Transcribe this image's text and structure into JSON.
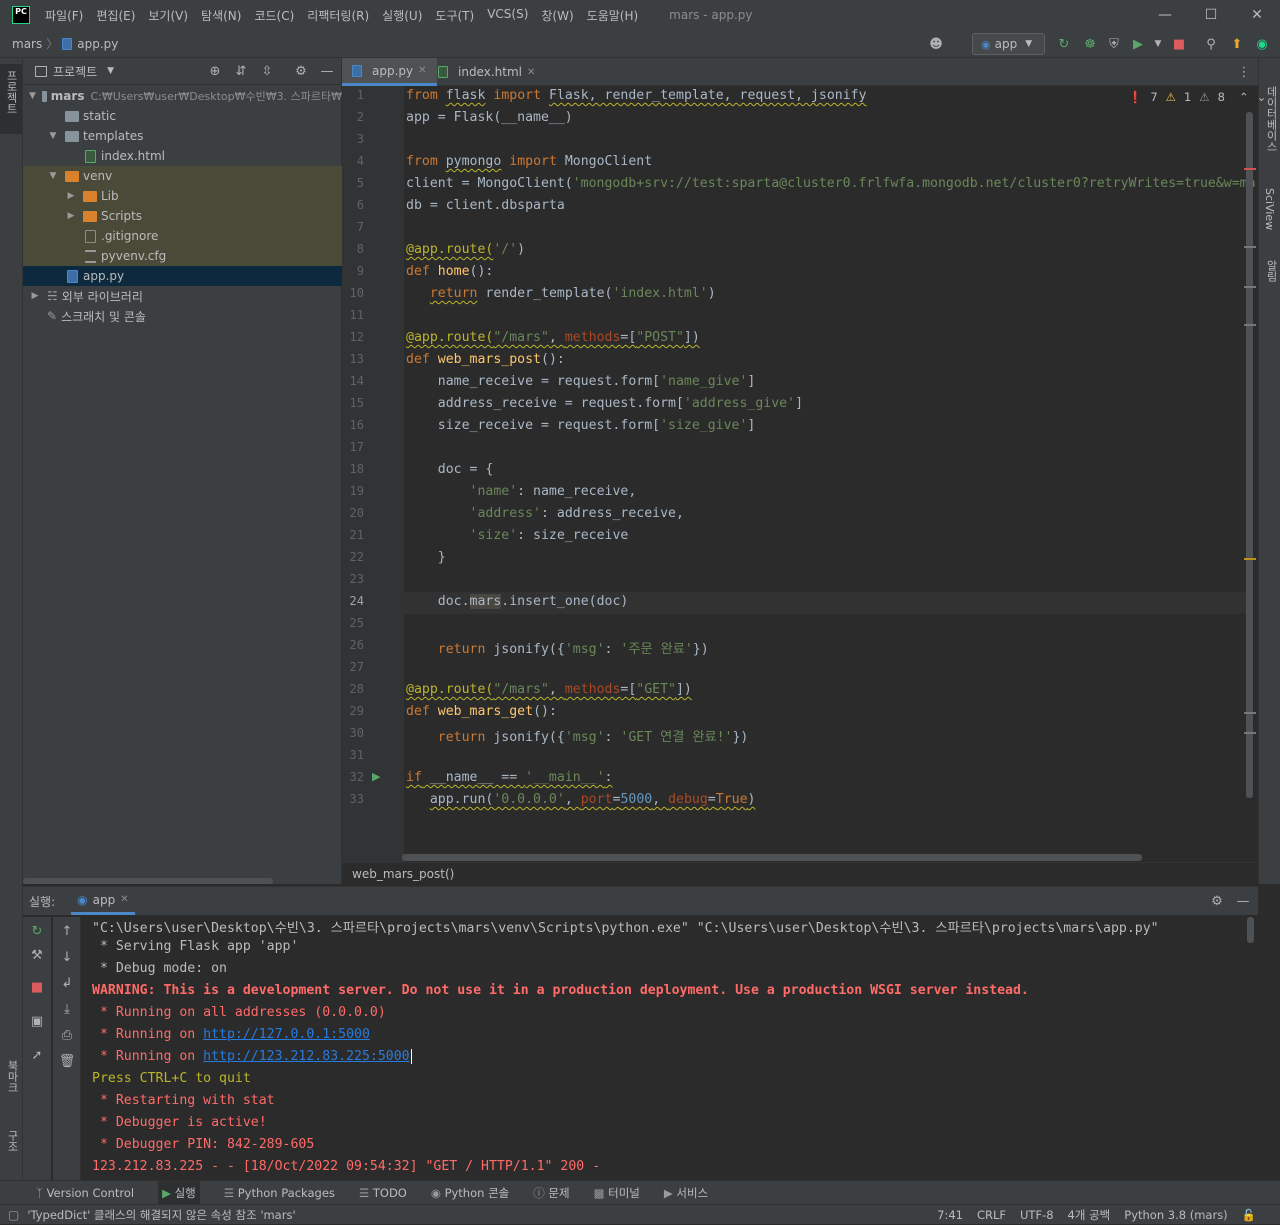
{
  "window": {
    "logo": "PC",
    "title": "mars - app.py",
    "menu": [
      "파일(F)",
      "편집(E)",
      "보기(V)",
      "탐색(N)",
      "코드(C)",
      "리팩터링(R)",
      "실행(U)",
      "도구(T)",
      "VCS(S)",
      "창(W)",
      "도움말(H)"
    ]
  },
  "navbar": {
    "project": "mars",
    "file": "app.py",
    "run_config": "app"
  },
  "left_strip": {
    "project_label": "프로젝트",
    "bookmark_label": "북마크",
    "structure_label": "구조"
  },
  "right_strip": {
    "database_label": "데이터베이스",
    "sciview_label": "SciView",
    "notify_label": "알림"
  },
  "project_panel": {
    "title": "프로젝트",
    "tree": [
      {
        "label": "mars",
        "path": "C:₩Users₩user₩Desktop₩수빈₩3. 스파르타₩",
        "type": "folder"
      },
      {
        "label": "static",
        "type": "folder"
      },
      {
        "label": "templates",
        "type": "folder"
      },
      {
        "label": "index.html",
        "type": "html"
      },
      {
        "label": "venv",
        "type": "folder-venv"
      },
      {
        "label": "Lib",
        "type": "folder-venv"
      },
      {
        "label": "Scripts",
        "type": "folder-venv"
      },
      {
        "label": ".gitignore",
        "type": "file"
      },
      {
        "label": "pyvenv.cfg",
        "type": "cfg"
      },
      {
        "label": "app.py",
        "type": "py"
      },
      {
        "label": "외부 라이브러리",
        "type": "lib"
      },
      {
        "label": "스크래치 및 콘솔",
        "type": "scratch"
      }
    ]
  },
  "editor": {
    "tabs": [
      {
        "label": "app.py",
        "active": true
      },
      {
        "label": "index.html",
        "active": false
      }
    ],
    "inspections": {
      "errors": "7",
      "warnings": "1",
      "weak": "8"
    },
    "line_numbers": [
      "1",
      "2",
      "3",
      "4",
      "5",
      "6",
      "7",
      "8",
      "9",
      "10",
      "11",
      "12",
      "13",
      "14",
      "15",
      "16",
      "17",
      "18",
      "19",
      "20",
      "21",
      "22",
      "23",
      "24",
      "25",
      "26",
      "27",
      "28",
      "29",
      "30",
      "31",
      "32",
      "33"
    ],
    "breadcrumb": "web_mars_post()",
    "code": {
      "l1_from": "from",
      "l1_flask": "flask",
      "l1_import": "import",
      "l1_rest": "Flask, render_template, request, jsonify",
      "l2": "app = Flask(__name__)",
      "l4_from": "from",
      "l4_mod": "pymongo",
      "l4_import": "import",
      "l4_rest": "MongoClient",
      "l5_pre": "client = MongoClient(",
      "l5_str": "'mongodb+srv://test:sparta@cluster0.frlfwfa.mongodb.net/cluster0?retryWrites=true&w=ma",
      "l6": "db = client.dbsparta",
      "l8_dec": "@app.route(",
      "l8_str": "'/'",
      "l8_end": ")",
      "l9_def": "def",
      "l9_fn": "home",
      "l9_end": "():",
      "l10_ret": "return",
      "l10_mid": "render_template(",
      "l10_str": "'index.html'",
      "l10_end": ")",
      "l12_dec": "@app.route(",
      "l12_str": "\"/mars\"",
      "l12_comma": ", ",
      "l12_par": "methods",
      "l12_eq": "=[",
      "l12_str2": "\"POST\"",
      "l12_end": "])",
      "l13_def": "def",
      "l13_fn": "web_mars_post",
      "l13_end": "():",
      "l14_pre": "name_receive = request.form[",
      "l14_str": "'name_give'",
      "l14_end": "]",
      "l15_pre": "address_receive = request.form[",
      "l15_str": "'address_give'",
      "l15_end": "]",
      "l16_pre": "size_receive = request.form[",
      "l16_str": "'size_give'",
      "l16_end": "]",
      "l18": "doc = {",
      "l19_str": "'name'",
      "l19_rest": ": name_receive,",
      "l20_str": "'address'",
      "l20_rest": ": address_receive,",
      "l21_str": "'size'",
      "l21_rest": ": size_receive",
      "l22": "}",
      "l24_pre": "doc.",
      "l24_mid": "mars",
      "l24_end": ".insert_one(doc)",
      "l26_ret": "return",
      "l26_mid": "jsonify({",
      "l26_str": "'msg'",
      "l26_colon": ": ",
      "l26_str2": "'주문 완료'",
      "l26_end": "})",
      "l28_dec": "@app.route(",
      "l28_str": "\"/mars\"",
      "l28_comma": ", ",
      "l28_par": "methods",
      "l28_eq": "=[",
      "l28_str2": "\"GET\"",
      "l28_end": "])",
      "l29_def": "def",
      "l29_fn": "web_mars_get",
      "l29_end": "():",
      "l30_ret": "return",
      "l30_mid": "jsonify({",
      "l30_str": "'msg'",
      "l30_colon": ": ",
      "l30_str2": "'GET 연결 완료!'",
      "l30_end": "})",
      "l32_if": "if",
      "l32_mid": " __name__ == ",
      "l32_str": "'__main__'",
      "l32_end": ":",
      "l33_pre": "app.run(",
      "l33_str": "'0.0.0.0'",
      "l33_c1": ", ",
      "l33_par": "port",
      "l33_eq": "=",
      "l33_num": "5000",
      "l33_c2": ", ",
      "l33_par2": "debug",
      "l33_eq2": "=",
      "l33_kw": "True",
      "l33_end": ")"
    }
  },
  "run_panel": {
    "label": "실행:",
    "tab": "app",
    "console": [
      {
        "text": "\"C:\\Users\\user\\Desktop\\수빈\\3. 스파르타\\projects\\mars\\venv\\Scripts\\python.exe\" \"C:\\Users\\user\\Desktop\\수빈\\3. 스파르타\\projects\\mars\\app.py\"",
        "color": "white"
      },
      {
        "text": " * Serving Flask app 'app'",
        "color": "white"
      },
      {
        "text": " * Debug mode: on",
        "color": "white"
      },
      {
        "text": "WARNING: This is a development server. Do not use it in a production deployment. Use a production WSGI server instead.",
        "color": "red-bold"
      },
      {
        "text": " * Running on all addresses (0.0.0.0)",
        "color": "red"
      },
      {
        "text": " * Running on ",
        "link": "http://127.0.0.1:5000",
        "color": "red"
      },
      {
        "text": " * Running on ",
        "link": "http://123.212.83.225:5000",
        "color": "red"
      },
      {
        "text": "Press CTRL+C to quit",
        "color": "yellow"
      },
      {
        "text": " * Restarting with stat",
        "color": "red"
      },
      {
        "text": " * Debugger is active!",
        "color": "red"
      },
      {
        "text": " * Debugger PIN: 842-289-605",
        "color": "red"
      },
      {
        "text": "123.212.83.225 - - [18/Oct/2022 09:54:32] \"GET / HTTP/1.1\" 200 -",
        "color": "red"
      }
    ]
  },
  "bottom_tabs": [
    "Version Control",
    "실행",
    "Python Packages",
    "TODO",
    "Python 콘솔",
    "문제",
    "터미널",
    "서비스"
  ],
  "status_bar": {
    "message": "'TypedDict' 클래스의 해결되지 않은 속성 참조 'mars'",
    "position": "7:41",
    "line_sep": "CRLF",
    "encoding": "UTF-8",
    "indent": "4개 공백",
    "interpreter": "Python 3.8 (mars)"
  }
}
